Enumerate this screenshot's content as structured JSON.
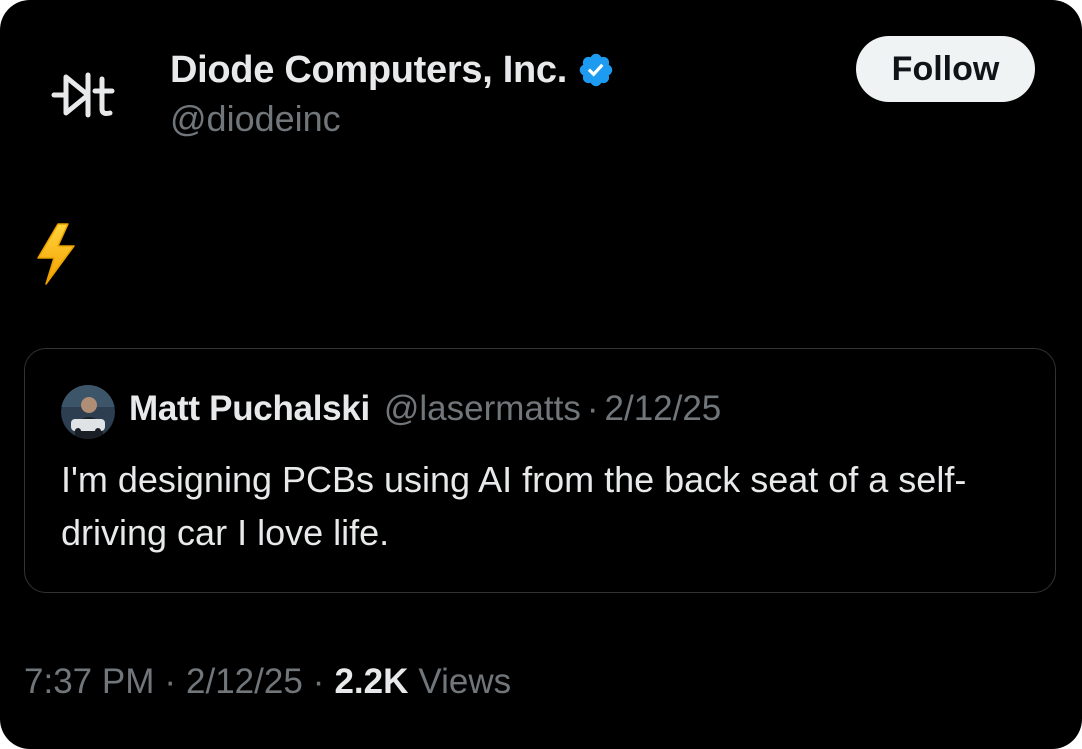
{
  "tweet": {
    "author": {
      "name": "Diode Computers, Inc.",
      "handle": "@diodeinc",
      "verified": true,
      "avatar_icon": "diode-logo-icon"
    },
    "follow_label": "Follow",
    "text_icon": "lightning-bolt-emoji",
    "quoted": {
      "author_name": "Matt Puchalski",
      "author_handle": "@lasermatts",
      "separator": "·",
      "date": "2/12/25",
      "text": "I'm designing PCBs using AI from the back seat of a self-driving car I love life."
    },
    "meta": {
      "time": "7:37 PM",
      "separator": "·",
      "date": "2/12/25",
      "views_count": "2.2K",
      "views_label": "Views"
    }
  },
  "colors": {
    "background": "#000000",
    "primary_text": "#e7e9ea",
    "secondary_text": "#71767b",
    "verified_blue": "#1d9bf0",
    "follow_button_bg": "#eff3f4",
    "border": "#2f3336"
  }
}
